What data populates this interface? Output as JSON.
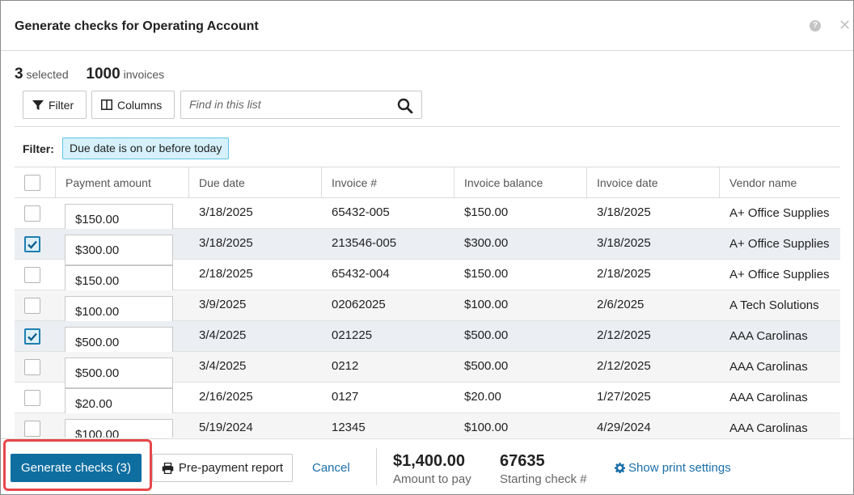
{
  "dialog": {
    "title": "Generate checks for Operating Account",
    "help_icon": "help-icon",
    "close_icon": "close-icon"
  },
  "summary": {
    "selected_count": "3",
    "selected_label": "selected",
    "invoice_count": "1000",
    "invoice_label": "invoices"
  },
  "toolbar": {
    "filter_label": "Filter",
    "columns_label": "Columns",
    "search_placeholder": "Find in this list"
  },
  "filter": {
    "label": "Filter:",
    "chip": "Due date is on or before today"
  },
  "table": {
    "columns": [
      "Payment amount",
      "Due date",
      "Invoice #",
      "Invoice balance",
      "Invoice date",
      "Vendor name"
    ],
    "rows": [
      {
        "checked": false,
        "amount": "$150.00",
        "due": "3/18/2025",
        "invoice": "65432-005",
        "balance": "$150.00",
        "date": "3/18/2025",
        "vendor": "A+ Office Supplies"
      },
      {
        "checked": true,
        "amount": "$300.00",
        "due": "3/18/2025",
        "invoice": "213546-005",
        "balance": "$300.00",
        "date": "3/18/2025",
        "vendor": "A+ Office Supplies"
      },
      {
        "checked": false,
        "amount": "$150.00",
        "due": "2/18/2025",
        "invoice": "65432-004",
        "balance": "$150.00",
        "date": "2/18/2025",
        "vendor": "A+ Office Supplies"
      },
      {
        "checked": false,
        "amount": "$100.00",
        "due": "3/9/2025",
        "invoice": "02062025",
        "balance": "$100.00",
        "date": "2/6/2025",
        "vendor": "A Tech Solutions"
      },
      {
        "checked": true,
        "amount": "$500.00",
        "due": "3/4/2025",
        "invoice": "021225",
        "balance": "$500.00",
        "date": "2/12/2025",
        "vendor": "AAA Carolinas"
      },
      {
        "checked": false,
        "amount": "$500.00",
        "due": "3/4/2025",
        "invoice": "0212",
        "balance": "$500.00",
        "date": "2/12/2025",
        "vendor": "AAA Carolinas"
      },
      {
        "checked": false,
        "amount": "$20.00",
        "due": "2/16/2025",
        "invoice": "0127",
        "balance": "$20.00",
        "date": "1/27/2025",
        "vendor": "AAA Carolinas"
      },
      {
        "checked": false,
        "amount": "$100.00",
        "due": "5/19/2024",
        "invoice": "12345",
        "balance": "$100.00",
        "date": "4/29/2024",
        "vendor": "AAA Carolinas"
      }
    ]
  },
  "footer": {
    "generate_label": "Generate checks (3)",
    "prepay_label": "Pre-payment report",
    "cancel_label": "Cancel",
    "amount_value": "$1,400.00",
    "amount_label": "Amount to pay",
    "check_value": "67635",
    "check_label": "Starting check #",
    "print_label": "Show print settings"
  },
  "colors": {
    "primary_button": "#0f6ea0",
    "link": "#1a6fa8",
    "chip_bg": "#d6f1fb",
    "highlight": "#e8474a"
  }
}
